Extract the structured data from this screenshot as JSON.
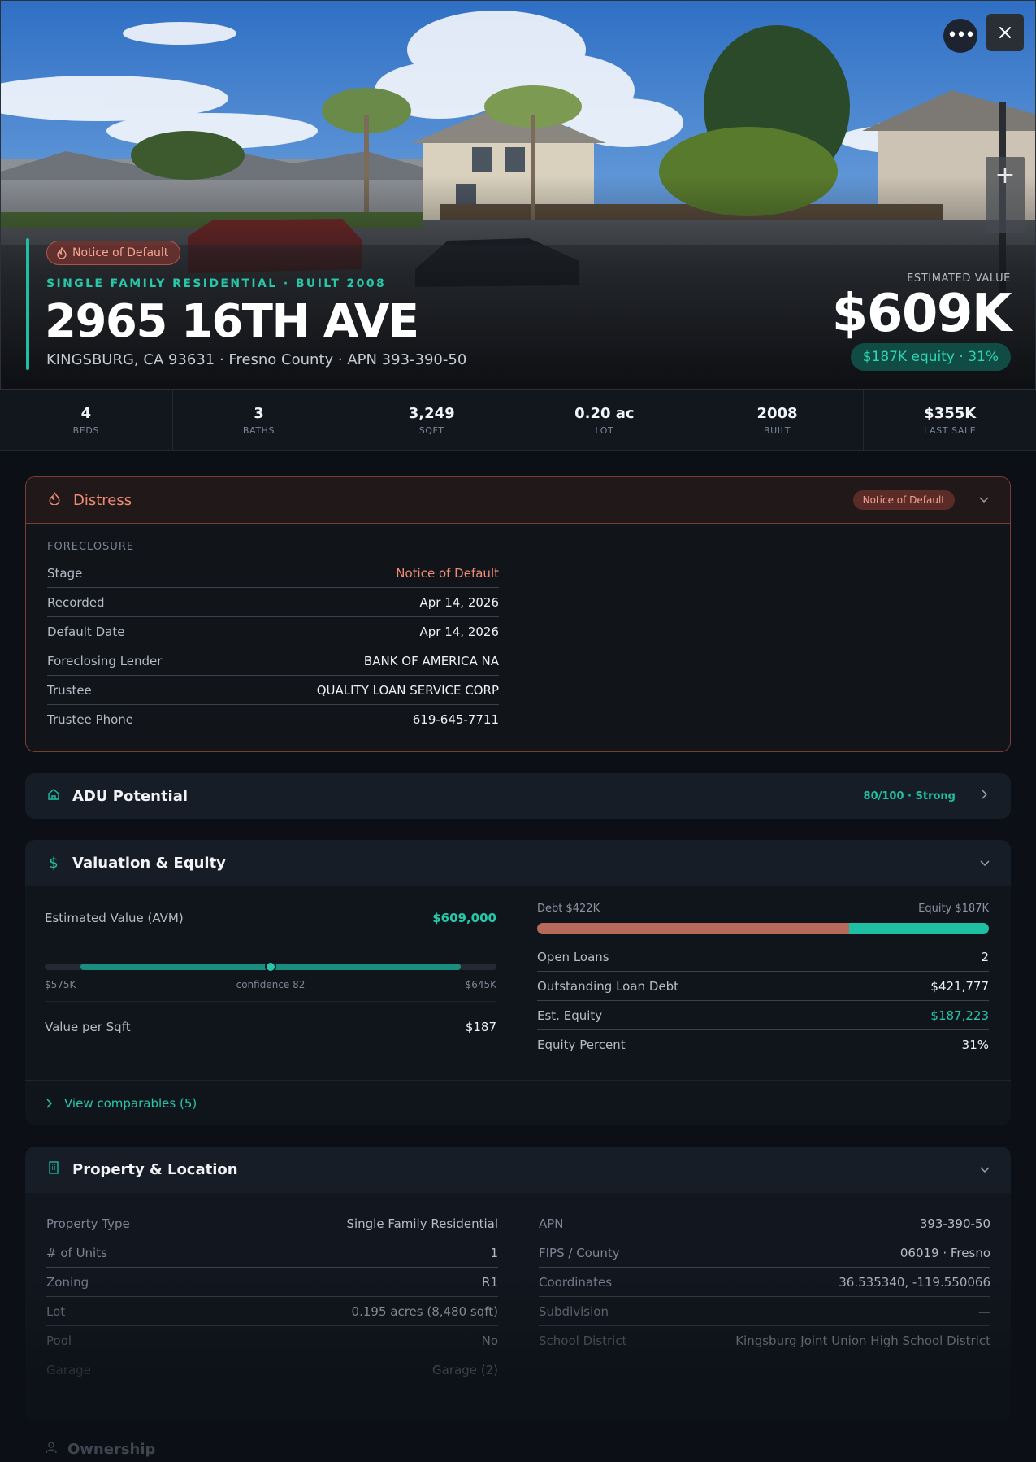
{
  "hero": {
    "badge": "Notice of Default",
    "subtitle": "SINGLE FAMILY RESIDENTIAL · BUILT 2008",
    "title": "2965 16TH AVE",
    "address": "KINGSBURG, CA 93631 · Fresno County · APN 393-390-50",
    "estimated_label": "ESTIMATED VALUE",
    "estimated_value": "$609K",
    "equity_pill": "$187K equity · 31%",
    "more_icon": "more-icon",
    "close_icon": "close-icon"
  },
  "stats": [
    {
      "value": "4",
      "label": "BEDS"
    },
    {
      "value": "3",
      "label": "BATHS"
    },
    {
      "value": "3,249",
      "label": "SQFT"
    },
    {
      "value": "0.20 ac",
      "label": "LOT"
    },
    {
      "value": "2008",
      "label": "BUILT"
    },
    {
      "value": "$355K",
      "label": "LAST SALE"
    }
  ],
  "distress": {
    "title": "Distress",
    "tag": "Notice of Default",
    "section_label": "FORECLOSURE",
    "rows": [
      {
        "k": "Stage",
        "v": "Notice of Default"
      },
      {
        "k": "Recorded",
        "v": "Apr 14, 2026"
      },
      {
        "k": "Default Date",
        "v": "Apr 14, 2026"
      },
      {
        "k": "Foreclosing Lender",
        "v": "BANK OF AMERICA NA"
      },
      {
        "k": "Trustee",
        "v": "QUALITY LOAN SERVICE CORP"
      },
      {
        "k": "Trustee Phone",
        "v": "619-645-7711"
      }
    ]
  },
  "adu": {
    "title": "ADU Potential",
    "score": "80/100 · Strong"
  },
  "valuation": {
    "title": "Valuation & Equity",
    "avm_label": "Estimated Value (AVM)",
    "avm_value": "$609,000",
    "range_low": "$575K",
    "range_high": "$645K",
    "confidence_label": "confidence 82",
    "avm_position": 0.5,
    "per_sqft_label": "Value per Sqft",
    "per_sqft_value": "$187",
    "debt_label": "Debt $422K",
    "equity_label": "Equity $187K",
    "debt_fraction": 0.69,
    "rows": [
      {
        "k": "Open Loans",
        "v": "2"
      },
      {
        "k": "Outstanding Loan Debt",
        "v": "$421,777"
      },
      {
        "k": "Est. Equity",
        "v": "$187,223"
      },
      {
        "k": "Equity Percent",
        "v": "31%"
      }
    ],
    "comparables": "View comparables (5)"
  },
  "property": {
    "title": "Property & Location",
    "left": [
      {
        "k": "Property Type",
        "v": "Single Family Residential"
      },
      {
        "k": "# of Units",
        "v": "1"
      },
      {
        "k": "Zoning",
        "v": "R1"
      },
      {
        "k": "Lot",
        "v": "0.195 acres (8,480 sqft)"
      },
      {
        "k": "Pool",
        "v": "No"
      },
      {
        "k": "Garage",
        "v": "Garage (2)"
      }
    ],
    "right": [
      {
        "k": "APN",
        "v": "393-390-50"
      },
      {
        "k": "FIPS / County",
        "v": "06019 · Fresno"
      },
      {
        "k": "Coordinates",
        "v": "36.535340, -119.550066"
      },
      {
        "k": "Subdivision",
        "v": "—"
      },
      {
        "k": "School District",
        "v": "Kingsburg Joint Union High School District"
      }
    ]
  },
  "ownership": {
    "title": "Ownership"
  },
  "colors": {
    "accent": "#1fbfa3",
    "distress": "#f08b75",
    "bg": "#0c1016"
  }
}
